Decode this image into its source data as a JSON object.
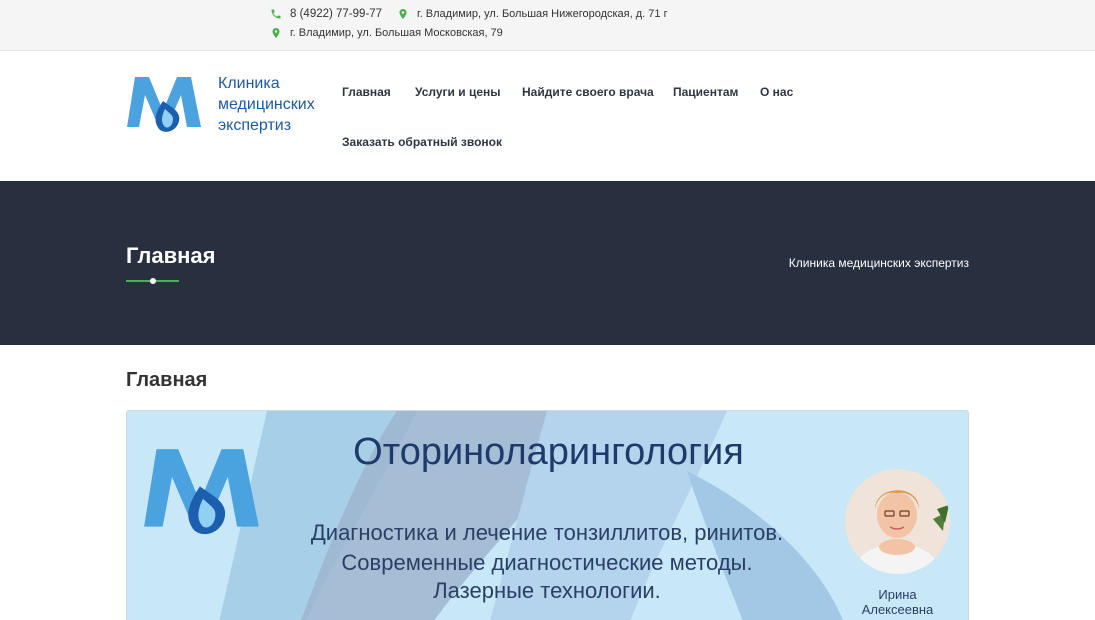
{
  "topbar": {
    "phone": "8 (4922) 77-99-77",
    "address_1": "г. Владимир, ул. Большая Нижегородская, д. 71 г",
    "address_2": "г. Владимир, ул. Большая Московская, 79",
    "icon_color": "#4caf50"
  },
  "header": {
    "logo_text": [
      "Клиника",
      "медицинских",
      "экспертиз"
    ],
    "nav": [
      "Главная",
      "Услуги и цены",
      "Найдите своего врача",
      "Пациентам",
      "О нас",
      "Заказать обратный звонок"
    ]
  },
  "hero": {
    "title": "Главная",
    "breadcrumb": "Клиника медицинских экспертиз",
    "background": "#283040",
    "accent": "#4caf50"
  },
  "content": {
    "heading": "Главная",
    "banner": {
      "title": "Оториноларингология",
      "lines": [
        "Диагностика и лечение тонзиллитов, ринитов.",
        "Современные диагностические методы.",
        "Лазерные технологии."
      ],
      "doctor_name": [
        "Ирина",
        "Алексеевна"
      ]
    }
  },
  "icons": {
    "phone": "phone-icon",
    "location": "map-pin-icon"
  }
}
